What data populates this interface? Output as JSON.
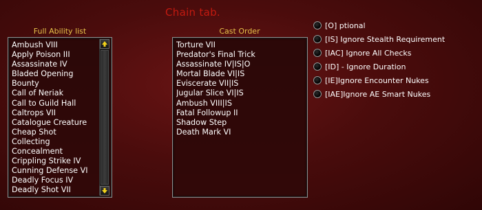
{
  "window": {
    "title": "Chain tab."
  },
  "full_list": {
    "caption": "Full Ability list",
    "items": [
      "Ambush VIII",
      "Apply Poison III",
      "Assassinate IV",
      "Bladed Opening",
      "Bounty",
      "Call of Neriak",
      "Call to Guild Hall",
      "Caltrops VII",
      "Catalogue Creature",
      "Cheap Shot",
      "Collecting",
      "Concealment",
      "Crippling Strike IV",
      "Cunning Defense VI",
      "Deadly Focus IV",
      "Deadly Shot VII"
    ],
    "scroll_up_icon": "arrow-up-icon",
    "scroll_down_icon": "arrow-down-icon"
  },
  "cast_list": {
    "caption": "Cast Order",
    "items": [
      "Torture VII",
      "Predator's Final Trick",
      "Assassinate IV|IS|O",
      "Mortal Blade VI|IS",
      "Eviscerate VII|IS",
      "Jugular Slice VI|IS",
      "Ambush VIII|IS",
      "Fatal Followup II",
      "Shadow Step",
      "Death Mark VI"
    ]
  },
  "options": [
    {
      "label": "[O] ptional"
    },
    {
      "label": "[IS] Ignore Stealth Requirement"
    },
    {
      "label": "[IAC] Ignore All Checks"
    },
    {
      "label": "[ID] - Ignore Duration"
    },
    {
      "label": "[IE]Ignore Encounter Nukes"
    },
    {
      "label": "[IAE]Ignore AE Smart Nukes"
    }
  ],
  "colors": {
    "title": "#c41a10",
    "caption": "#e6c24a",
    "scroll_arrow": "#f2d21a",
    "background": "#4a0c0c"
  }
}
